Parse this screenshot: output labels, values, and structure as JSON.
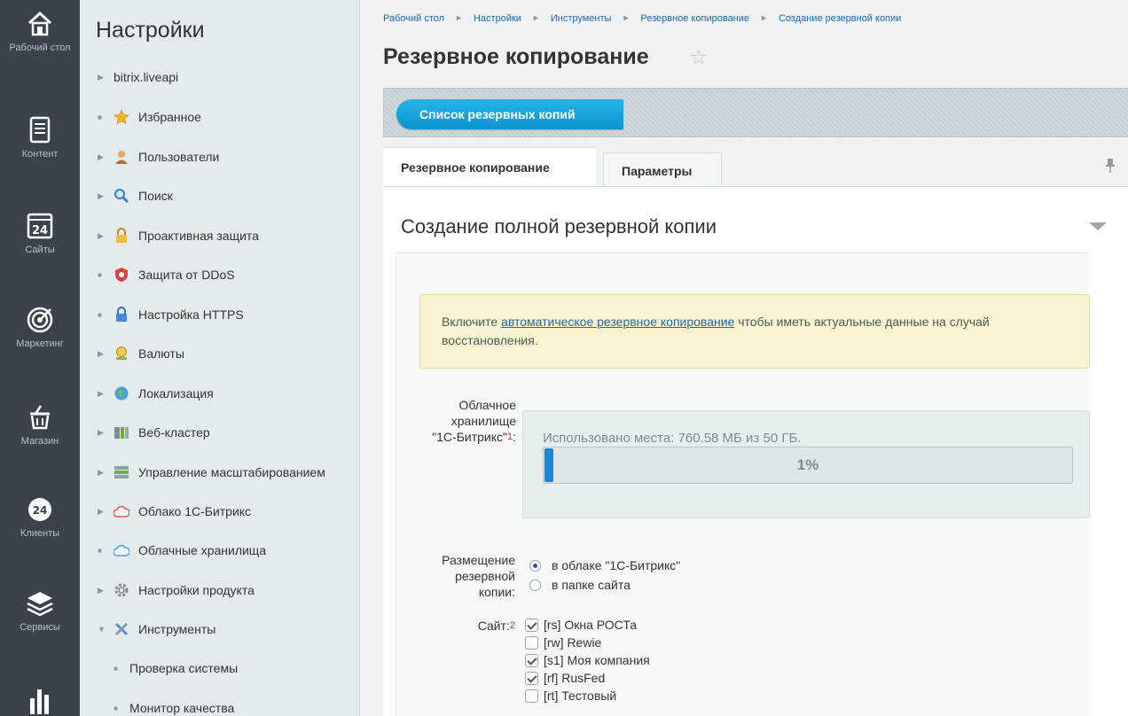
{
  "rail": {
    "items": [
      {
        "label": "Рабочий стол",
        "icon": "home-icon"
      },
      {
        "label": "Контент",
        "icon": "document-icon"
      },
      {
        "label": "Сайты",
        "icon": "calendar-24-icon"
      },
      {
        "label": "Маркетинг",
        "icon": "target-icon"
      },
      {
        "label": "Магазин",
        "icon": "basket-icon"
      },
      {
        "label": "Клиенты",
        "icon": "crm-24-icon"
      },
      {
        "label": "Сервисы",
        "icon": "layers-icon"
      },
      {
        "label": "",
        "icon": "analytics-icon"
      }
    ]
  },
  "panel": {
    "title": "Настройки",
    "items": [
      {
        "label": "bitrix.liveapi",
        "kind": "arrow"
      },
      {
        "label": "Избранное",
        "kind": "bullet",
        "icon": "star-icon"
      },
      {
        "label": "Пользователи",
        "kind": "arrow",
        "icon": "user-icon"
      },
      {
        "label": "Поиск",
        "kind": "arrow",
        "icon": "magnifier-icon"
      },
      {
        "label": "Проактивная защита",
        "kind": "arrow",
        "icon": "lock-icon"
      },
      {
        "label": "Защита от DDoS",
        "kind": "bullet",
        "icon": "shield-icon"
      },
      {
        "label": "Настройка HTTPS",
        "kind": "bullet",
        "icon": "https-lock-icon"
      },
      {
        "label": "Валюты",
        "kind": "arrow",
        "icon": "currency-icon"
      },
      {
        "label": "Локализация",
        "kind": "arrow",
        "icon": "globe-icon"
      },
      {
        "label": "Веб-кластер",
        "kind": "arrow",
        "icon": "cluster-icon"
      },
      {
        "label": "Управление масштабированием",
        "kind": "arrow",
        "icon": "server-icon"
      },
      {
        "label": "Облако 1С-Битрикс",
        "kind": "arrow",
        "icon": "cloud-icon"
      },
      {
        "label": "Облачные хранилища",
        "kind": "bullet",
        "icon": "cloud-storage-icon"
      },
      {
        "label": "Настройки продукта",
        "kind": "arrow",
        "icon": "gear-icon"
      },
      {
        "label": "Инструменты",
        "kind": "open",
        "icon": "tools-icon"
      },
      {
        "label": "Проверка системы",
        "kind": "sub"
      },
      {
        "label": "Монитор качества",
        "kind": "sub"
      }
    ]
  },
  "breadcrumb": [
    "Рабочий стол",
    "Настройки",
    "Инструменты",
    "Резервное копирование",
    "Создание резервной копии"
  ],
  "page": {
    "title": "Резервное копирование",
    "list_button": "Список резервных копий",
    "tabs": [
      "Резервное копирование",
      "Параметры"
    ],
    "section_title": "Создание полной резервной копии"
  },
  "notice": {
    "before": "Включите ",
    "link": "автоматическое резервное копирование",
    "after": " чтобы иметь актуальные данные на случай восстановления."
  },
  "storage": {
    "label_line1": "Облачное",
    "label_line2": "хранилище",
    "label_line3": "\"1С-Битрикс\"",
    "footnote": "1",
    "label_colon": ":",
    "usage_text": "Использовано места: 760.58 МБ из 50 ГБ.",
    "percent": 1,
    "percent_text": "1%"
  },
  "placement": {
    "label_line1": "Размещение",
    "label_line2": "резервной",
    "label_line3": "копии:",
    "options": [
      {
        "label": "в облаке \"1С-Битрикс\"",
        "checked": true
      },
      {
        "label": "в папке сайта",
        "checked": false
      }
    ]
  },
  "sites": {
    "label": "Сайт:",
    "footnote": "2",
    "items": [
      {
        "label": "[rs] Окна РОСТа",
        "checked": true
      },
      {
        "label": "[rw] Rewie",
        "checked": false
      },
      {
        "label": "[s1] Моя компания",
        "checked": true
      },
      {
        "label": "[rf] RusFed",
        "checked": true
      },
      {
        "label": "[rt] Тестовый",
        "checked": false
      }
    ]
  },
  "colors": {
    "accent": "#0d93d1",
    "rail_bg": "#3a434c",
    "progress_fill": "#1a87d4",
    "notice_bg": "#f8f3d1"
  }
}
